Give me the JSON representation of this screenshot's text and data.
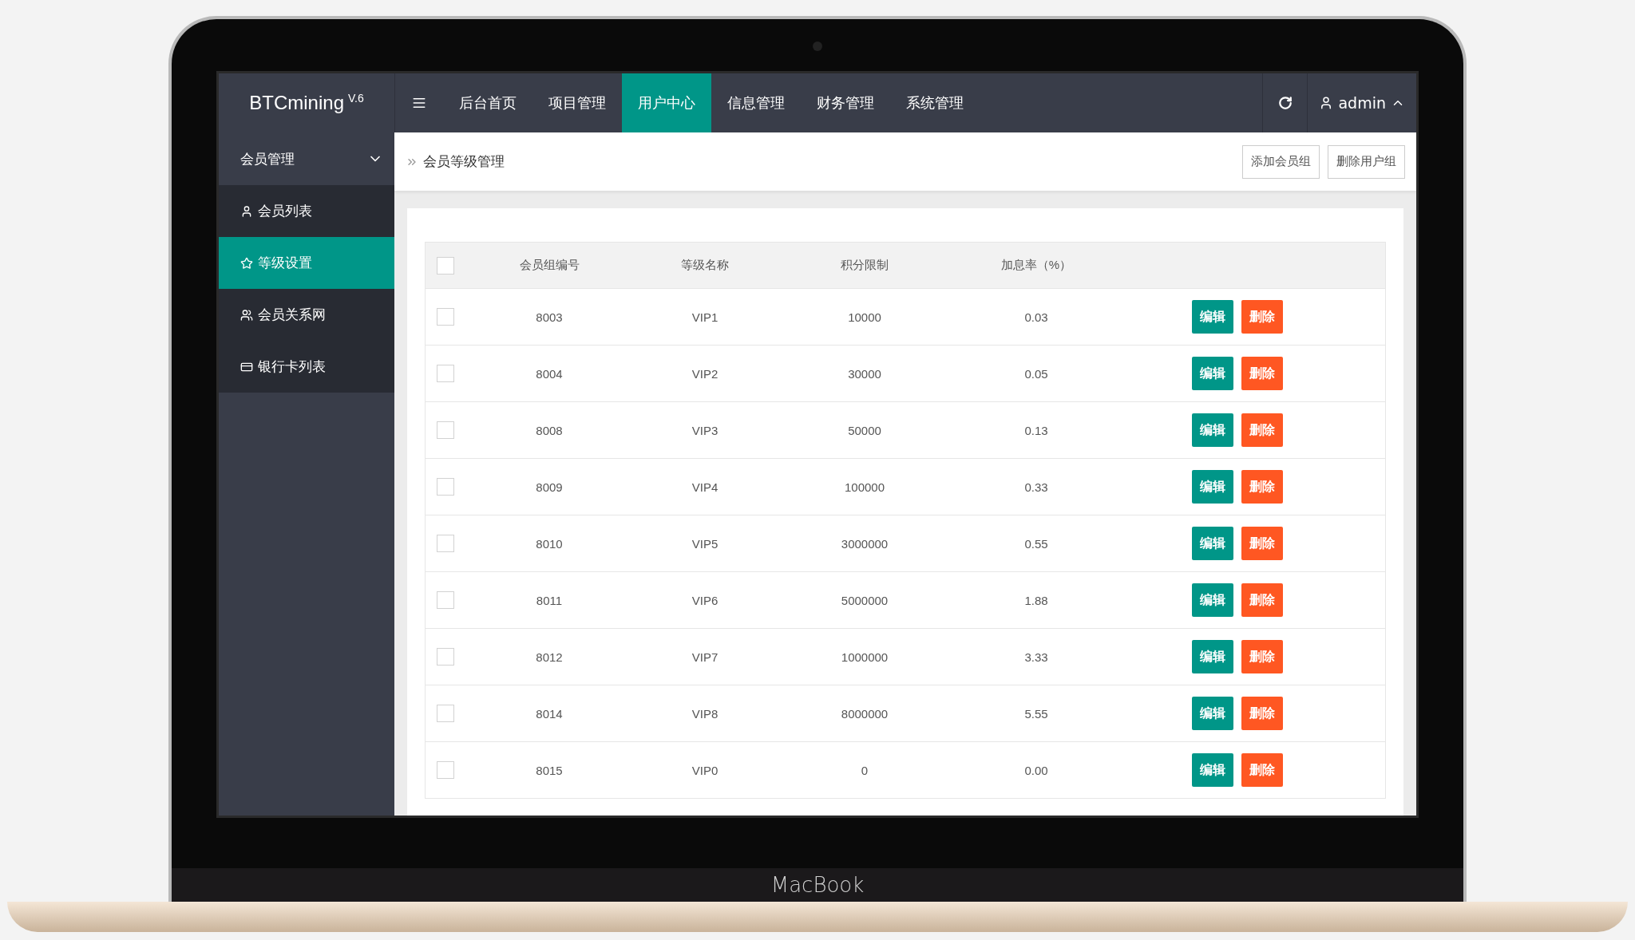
{
  "device": {
    "label": "MacBook"
  },
  "brand": {
    "name": "BTCmining",
    "version": "V.6"
  },
  "nav": [
    {
      "label": "后台首页",
      "selected": false
    },
    {
      "label": "项目管理",
      "selected": false
    },
    {
      "label": "用户中心",
      "selected": true
    },
    {
      "label": "信息管理",
      "selected": false
    },
    {
      "label": "财务管理",
      "selected": false
    },
    {
      "label": "系统管理",
      "selected": false
    }
  ],
  "user": {
    "name": "admin"
  },
  "sidebar": {
    "group": {
      "label": "会员管理",
      "expanded": true
    },
    "items": [
      {
        "label": "会员列表",
        "kind": "user",
        "selected": false
      },
      {
        "label": "等级设置",
        "kind": "star",
        "selected": true
      },
      {
        "label": "会员关系网",
        "kind": "users",
        "selected": false
      },
      {
        "label": "银行卡列表",
        "kind": "card",
        "selected": false
      }
    ]
  },
  "breadcrumb": "会员等级管理",
  "actions": [
    "添加会员组",
    "删除用户组"
  ],
  "table": {
    "header_checked": false,
    "columns": [
      "会员组编号",
      "等级名称",
      "积分限制",
      "加息率（%）"
    ],
    "rows": [
      {
        "checked": false,
        "cells": [
          "8003",
          "VIP1",
          "10000",
          "0.03"
        ],
        "edit": "编辑",
        "delete": "删除"
      },
      {
        "checked": false,
        "cells": [
          "8004",
          "VIP2",
          "30000",
          "0.05"
        ],
        "edit": "编辑",
        "delete": "删除"
      },
      {
        "checked": false,
        "cells": [
          "8008",
          "VIP3",
          "50000",
          "0.13"
        ],
        "edit": "编辑",
        "delete": "删除"
      },
      {
        "checked": false,
        "cells": [
          "8009",
          "VIP4",
          "100000",
          "0.33"
        ],
        "edit": "编辑",
        "delete": "删除"
      },
      {
        "checked": false,
        "cells": [
          "8010",
          "VIP5",
          "3000000",
          "0.55"
        ],
        "edit": "编辑",
        "delete": "删除"
      },
      {
        "checked": false,
        "cells": [
          "8011",
          "VIP6",
          "5000000",
          "1.88"
        ],
        "edit": "编辑",
        "delete": "删除"
      },
      {
        "checked": false,
        "cells": [
          "8012",
          "VIP7",
          "1000000",
          "3.33"
        ],
        "edit": "编辑",
        "delete": "删除"
      },
      {
        "checked": false,
        "cells": [
          "8014",
          "VIP8",
          "8000000",
          "5.55"
        ],
        "edit": "编辑",
        "delete": "删除"
      },
      {
        "checked": false,
        "cells": [
          "8015",
          "VIP0",
          "0",
          "0.00"
        ],
        "edit": "编辑",
        "delete": "删除"
      }
    ]
  }
}
